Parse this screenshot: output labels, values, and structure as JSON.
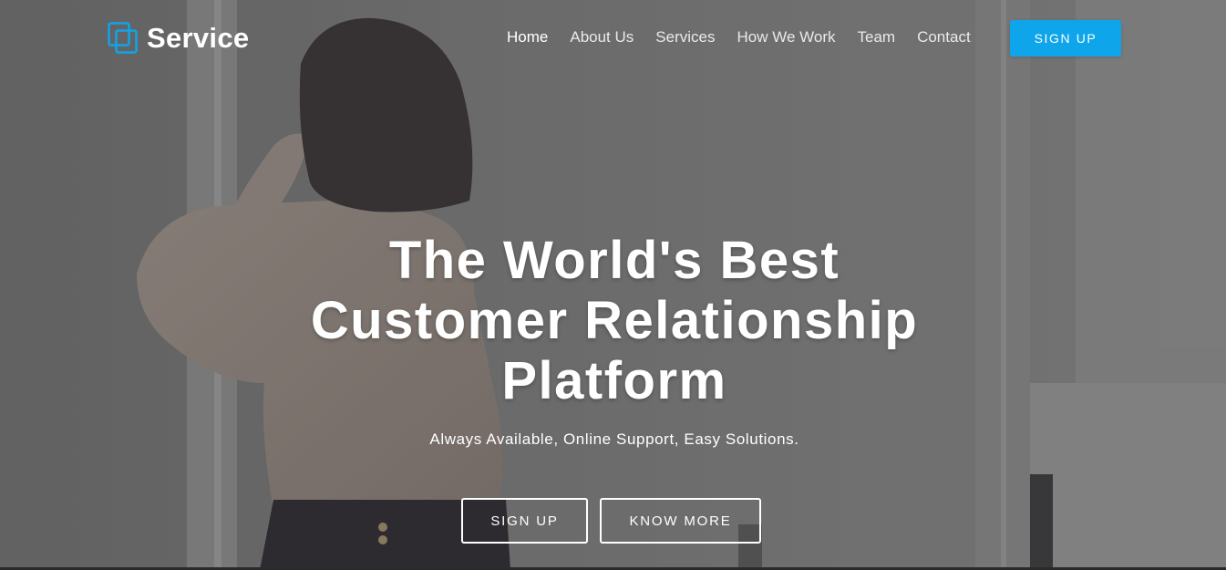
{
  "brand": {
    "name": "Service",
    "icon": "stacked-squares-icon",
    "accent": "#0ea5ea"
  },
  "nav": {
    "items": [
      {
        "label": "Home",
        "active": true
      },
      {
        "label": "About Us",
        "active": false
      },
      {
        "label": "Services",
        "active": false
      },
      {
        "label": "How We Work",
        "active": false
      },
      {
        "label": "Team",
        "active": false
      },
      {
        "label": "Contact",
        "active": false
      }
    ],
    "signup_label": "SIGN UP"
  },
  "hero": {
    "title_lines": [
      "The World's Best",
      "Customer Relationship",
      "Platform"
    ],
    "subtitle": "Always Available, Online Support, Easy Solutions.",
    "signup_label": "SIGN UP",
    "know_more_label": "KNOW MORE",
    "background": "woman-in-sweater-by-window-photo"
  }
}
